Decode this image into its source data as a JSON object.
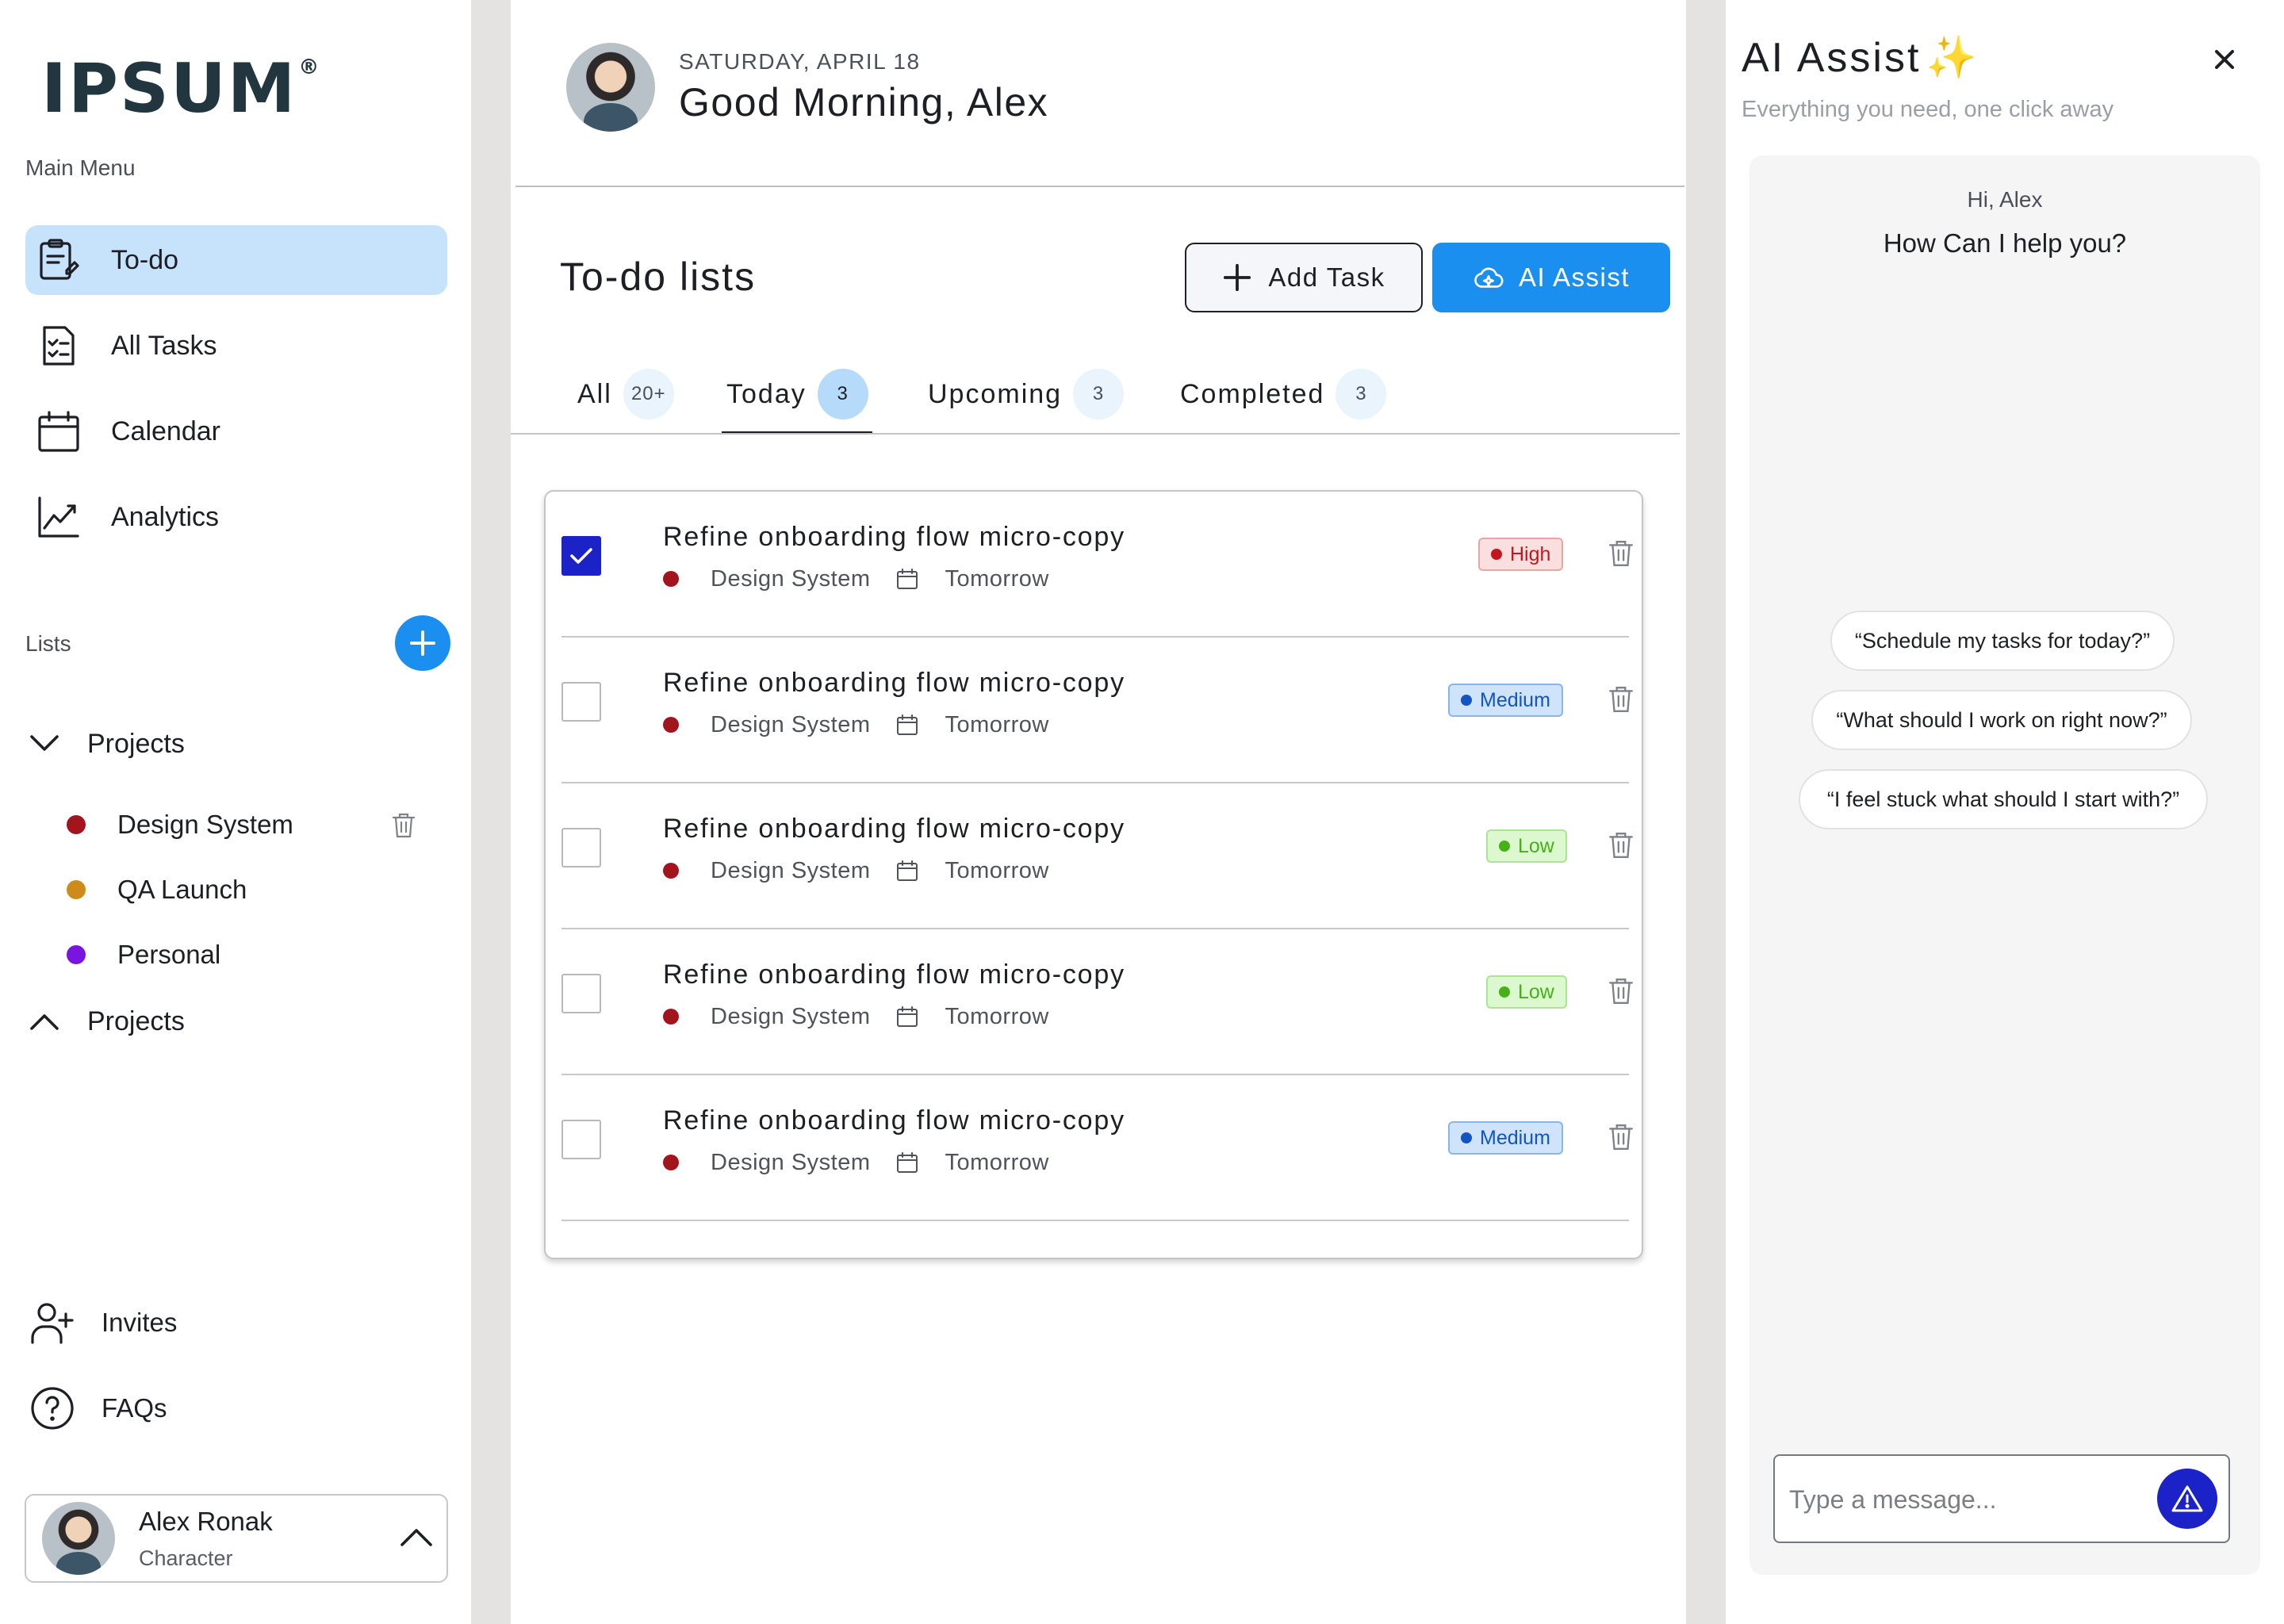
{
  "brand": {
    "logo": "IPSUM",
    "logo_mark": "®"
  },
  "sidebar": {
    "menu_caption": "Main Menu",
    "nav": [
      {
        "label": "To-do",
        "icon": "clipboard-edit-icon",
        "active": true
      },
      {
        "label": "All Tasks",
        "icon": "checklist-icon",
        "active": false
      },
      {
        "label": "Calendar",
        "icon": "calendar-icon",
        "active": false
      },
      {
        "label": "Analytics",
        "icon": "chart-line-icon",
        "active": false
      }
    ],
    "lists_caption": "Lists",
    "groups": [
      {
        "label": "Projects",
        "expanded": true
      },
      {
        "label": "Projects",
        "expanded": false
      }
    ],
    "lists": [
      {
        "label": "Design System",
        "color": "#a3141c"
      },
      {
        "label": "QA Launch",
        "color": "#cd8c1a"
      },
      {
        "label": "Personal",
        "color": "#7a14e0"
      }
    ],
    "bottom": [
      {
        "label": "Invites",
        "icon": "user-plus-icon"
      },
      {
        "label": "FAQs",
        "icon": "help-circle-icon"
      }
    ],
    "profile": {
      "name": "Alex Ronak",
      "role": "Character"
    }
  },
  "header": {
    "date": "SATURDAY, APRIL 18",
    "greeting": "Good Morning, Alex"
  },
  "todo": {
    "title": "To-do lists",
    "add_task_label": "Add Task",
    "ai_assist_label": "AI Assist",
    "tabs": [
      {
        "label": "All",
        "count": "20+",
        "active": false
      },
      {
        "label": "Today",
        "count": "3",
        "active": true
      },
      {
        "label": "Upcoming",
        "count": "3",
        "active": false
      },
      {
        "label": "Completed",
        "count": "3",
        "active": false
      }
    ],
    "tasks": [
      {
        "title": "Refine onboarding flow micro-copy",
        "list": "Design System",
        "due": "Tomorrow",
        "priority": "High",
        "checked": true
      },
      {
        "title": "Refine onboarding flow micro-copy",
        "list": "Design System",
        "due": "Tomorrow",
        "priority": "Medium",
        "checked": false
      },
      {
        "title": "Refine onboarding flow micro-copy",
        "list": "Design System",
        "due": "Tomorrow",
        "priority": "Low",
        "checked": false
      },
      {
        "title": "Refine onboarding flow micro-copy",
        "list": "Design System",
        "due": "Tomorrow",
        "priority": "Low",
        "checked": false
      },
      {
        "title": "Refine onboarding flow micro-copy",
        "list": "Design System",
        "due": "Tomorrow",
        "priority": "Medium",
        "checked": false
      }
    ]
  },
  "assist": {
    "title": "AI Assist",
    "title_emoji": "✨",
    "subtitle": "Everything you need, one click away",
    "hi": "Hi, Alex",
    "question": "How Can I help you?",
    "suggestions": [
      "“Schedule my tasks for today?”",
      "“What should I work on right now?”",
      "“I feel stuck what should I start with?”"
    ],
    "input_placeholder": "Type a message...",
    "accent": "#1a22c8"
  },
  "colors": {
    "primary": "#1a8ff0",
    "active_nav": "#c7e2fb",
    "checked": "#1a22c8"
  }
}
